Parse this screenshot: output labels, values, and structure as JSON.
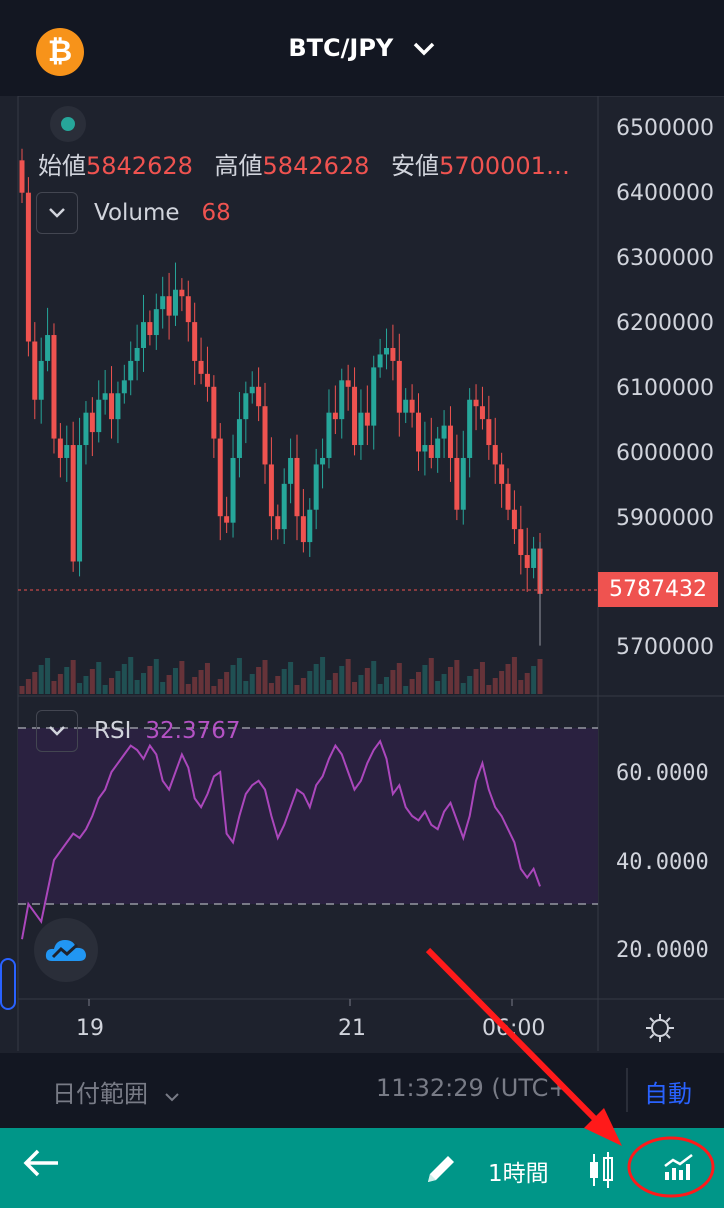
{
  "header": {
    "coin_icon": "bitcoin-icon",
    "coin_symbol": "₿",
    "pair": "BTC/JPY"
  },
  "legend": {
    "open_label": "始値",
    "open_value": "5842628",
    "high_label": "高値",
    "high_value": "5842628",
    "low_label": "安値",
    "low_value": "5700001…"
  },
  "volume": {
    "label": "Volume",
    "value": "68"
  },
  "rsi": {
    "label": "RSI",
    "value": "32.3767",
    "axis": [
      "60.0000",
      "40.0000",
      "20.0000"
    ]
  },
  "price_axis": [
    "6500000",
    "6400000",
    "6300000",
    "6200000",
    "6100000",
    "6000000",
    "5900000",
    "5700000"
  ],
  "current_price": "5787432",
  "time_axis": [
    "19",
    "21",
    "06:00"
  ],
  "range_bar": {
    "label": "日付範囲",
    "time": "11:32:29 (UTC+",
    "auto": "自動"
  },
  "toolbar": {
    "interval": "1時間"
  },
  "colors": {
    "up": "#26a69a",
    "down": "#ef5350",
    "rsi": "#ab47bc",
    "toolbar": "#009688",
    "accent": "#2962ff"
  }
}
